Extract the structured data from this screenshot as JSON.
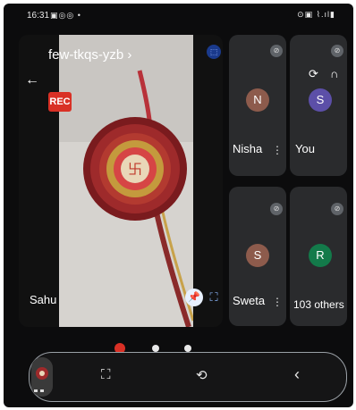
{
  "status_bar": {
    "time": "16:31",
    "notification_icons": "▣◎◎ •",
    "right_icons": "⊙▣ ⌇.ıl▮"
  },
  "meeting": {
    "title": "few-tkqs-yzb",
    "title_chevron": "›",
    "rec_label": "REC",
    "main_speaker": "Sahu"
  },
  "participants": [
    {
      "name": "Nisha",
      "initial": "N",
      "color": "#8d5b4c"
    },
    {
      "name": "You",
      "initial": "S",
      "color": "#5c4fa8"
    },
    {
      "name": "Sweta",
      "initial": "S",
      "color": "#8d5b4c"
    },
    {
      "name": "103 others",
      "initial": "R",
      "color": "#137a4a"
    }
  ],
  "icons": {
    "back": "back-arrow-icon",
    "pip": "picture-in-picture-icon",
    "pin": "pin-icon",
    "expand": "expand-icon",
    "mic_off": "mic-off-icon",
    "camera_switch": "camera-switch-icon",
    "audio": "headphones-icon",
    "screenshot": "screenshot-icon",
    "rotate": "rotate-icon",
    "back_nav": "back-chevron-icon"
  },
  "colors": {
    "rec": "#d93025",
    "accent": "#1a73e8",
    "tile_bg": "#2a2b2d"
  }
}
